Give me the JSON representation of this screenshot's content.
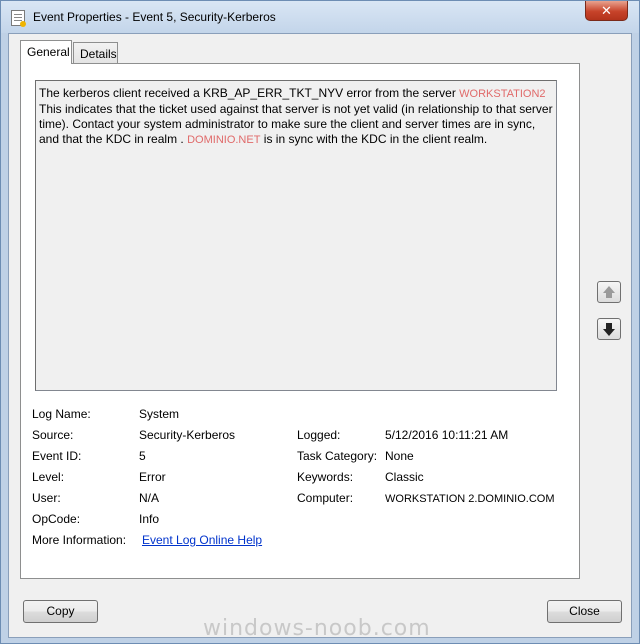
{
  "window": {
    "title": "Event Properties - Event 5, Security-Kerberos",
    "close_glyph": "✕"
  },
  "tabs": [
    {
      "label": "General",
      "active": true
    },
    {
      "label": "Details",
      "active": false
    }
  ],
  "description": {
    "part1": "The kerberos client received a KRB_AP_ERR_TKT_NYV error from the server",
    "server_redacted": "WORKSTATION2",
    "part2": "This indicates that the ticket used against that server is not yet valid (in relationship to that server time). Contact your system administrator to make sure the client and server times are in sync, and that the KDC in realm .",
    "realm_redacted": "DOMINIO.NET",
    "part3": "is in sync with the KDC in the client realm."
  },
  "fields": {
    "log_name": {
      "label": "Log Name:",
      "value": "System"
    },
    "source": {
      "label": "Source:",
      "value": "Security-Kerberos"
    },
    "event_id": {
      "label": "Event ID:",
      "value": "5"
    },
    "level": {
      "label": "Level:",
      "value": "Error"
    },
    "user": {
      "label": "User:",
      "value": "N/A"
    },
    "opcode": {
      "label": "OpCode:",
      "value": "Info"
    },
    "more_info": {
      "label": "More Information:",
      "value": "Event Log Online Help"
    },
    "logged": {
      "label": "Logged:",
      "value": "5/12/2016 10:11:21 AM"
    },
    "task_category": {
      "label": "Task Category:",
      "value": "None"
    },
    "keywords": {
      "label": "Keywords:",
      "value": "Classic"
    },
    "computer": {
      "label": "Computer:",
      "value": "WORKSTATION 2.DOMINIO.COM"
    }
  },
  "buttons": {
    "copy": "Copy",
    "close": "Close"
  },
  "watermark": "windows-noob.com",
  "icons": [
    "event-viewer-icon",
    "close-icon",
    "arrow-up-icon",
    "arrow-down-icon"
  ]
}
